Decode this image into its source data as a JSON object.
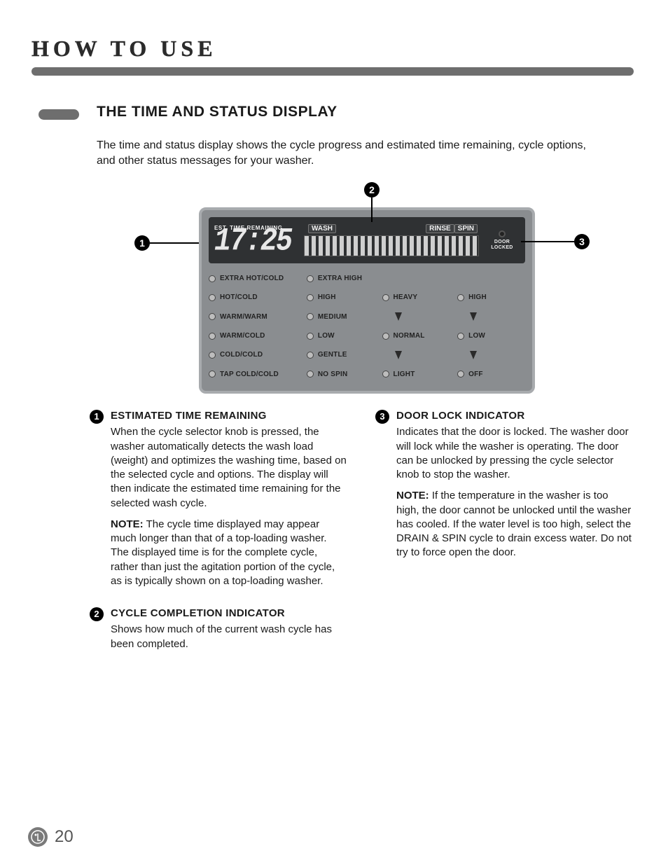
{
  "chapter_title": "HOW TO USE",
  "section_title": "THE TIME AND STATUS DISPLAY",
  "intro": "The time and status display shows the cycle progress and estimated time remaining, cycle options, and other status messages for your washer.",
  "callouts": {
    "c1": "1",
    "c2": "2",
    "c3": "3"
  },
  "display": {
    "time_caption": "EST. TIME REMAINING",
    "time_value": "17:25",
    "phase_wash": "WASH",
    "phase_rinse": "RINSE",
    "phase_spin": "SPIN",
    "door_locked": "DOOR LOCKED",
    "col1": [
      "EXTRA HOT/COLD",
      "HOT/COLD",
      "WARM/WARM",
      "WARM/COLD",
      "COLD/COLD",
      "TAP COLD/COLD"
    ],
    "col2": [
      "EXTRA HIGH",
      "HIGH",
      "MEDIUM",
      "LOW",
      "GENTLE",
      "NO SPIN"
    ],
    "col3": [
      "",
      "HEAVY",
      "",
      "NORMAL",
      "",
      "LIGHT"
    ],
    "col4": [
      "",
      "HIGH",
      "",
      "LOW",
      "",
      "OFF"
    ]
  },
  "body": {
    "i1": {
      "num": "1",
      "title": "ESTIMATED TIME REMAINING",
      "p1": "When the cycle selector knob is pressed, the washer automatically detects the wash load (weight) and optimizes the washing time, based on the selected cycle and options. The display will then indicate the estimated time remaining for the selected wash cycle.",
      "note_label": "NOTE:",
      "note": " The cycle time displayed may appear much longer than that of a top-loading washer. The displayed time is for the complete cycle, rather than just the agitation portion of the cycle, as is typically shown on a top-loading washer."
    },
    "i2": {
      "num": "2",
      "title": "CYCLE COMPLETION INDICATOR",
      "p1": "Shows how much of the current wash cycle has been completed."
    },
    "i3": {
      "num": "3",
      "title": "DOOR LOCK INDICATOR",
      "p1": "Indicates that the door is locked. The washer door will lock while the washer is operating. The door can be unlocked by pressing the cycle selector knob to stop the washer.",
      "note_label": "NOTE:",
      "note": " If the temperature in the washer is too high, the door cannot be unlocked until the washer has cooled. If the water level is too high, select the DRAIN & SPIN cycle to drain excess water. Do not try to force open the door."
    }
  },
  "page_number": "20"
}
